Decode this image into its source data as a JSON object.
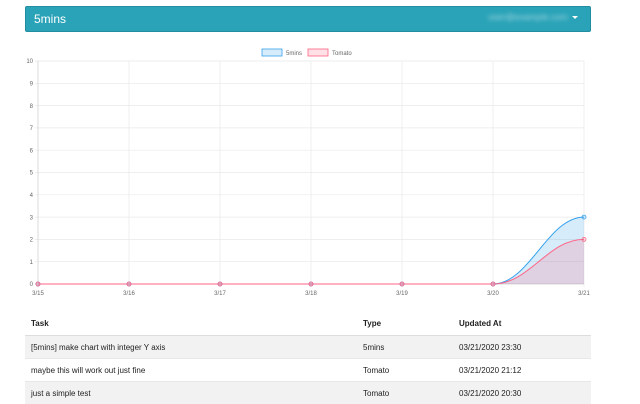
{
  "navbar": {
    "brand": "5mins",
    "user": "user@example.com"
  },
  "chart_data": {
    "type": "line",
    "categories": [
      "3/15",
      "3/16",
      "3/17",
      "3/18",
      "3/19",
      "3/20",
      "3/21"
    ],
    "series": [
      {
        "name": "5mins",
        "values": [
          0,
          0,
          0,
          0,
          0,
          0,
          3
        ],
        "color": "#36a2eb",
        "fill": "rgba(54,162,235,0.2)"
      },
      {
        "name": "Tomato",
        "values": [
          0,
          0,
          0,
          0,
          0,
          0,
          2
        ],
        "color": "#ff6384",
        "fill": "rgba(255,99,132,0.2)"
      }
    ],
    "ylim": [
      0,
      10
    ],
    "yticks": [
      "0",
      "1",
      "2",
      "3",
      "4",
      "5",
      "6",
      "7",
      "8",
      "9",
      "10"
    ],
    "grid": true,
    "legend": "top"
  },
  "table": {
    "headers": [
      "Task",
      "Type",
      "Updated At"
    ],
    "rows": [
      [
        "[5mins] make chart with integer Y axis",
        "5mins",
        "03/21/2020 23:30"
      ],
      [
        "maybe this will work out just fine",
        "Tomato",
        "03/21/2020 21:12"
      ],
      [
        "just a simple test",
        "Tomato",
        "03/21/2020 20:30"
      ]
    ]
  }
}
